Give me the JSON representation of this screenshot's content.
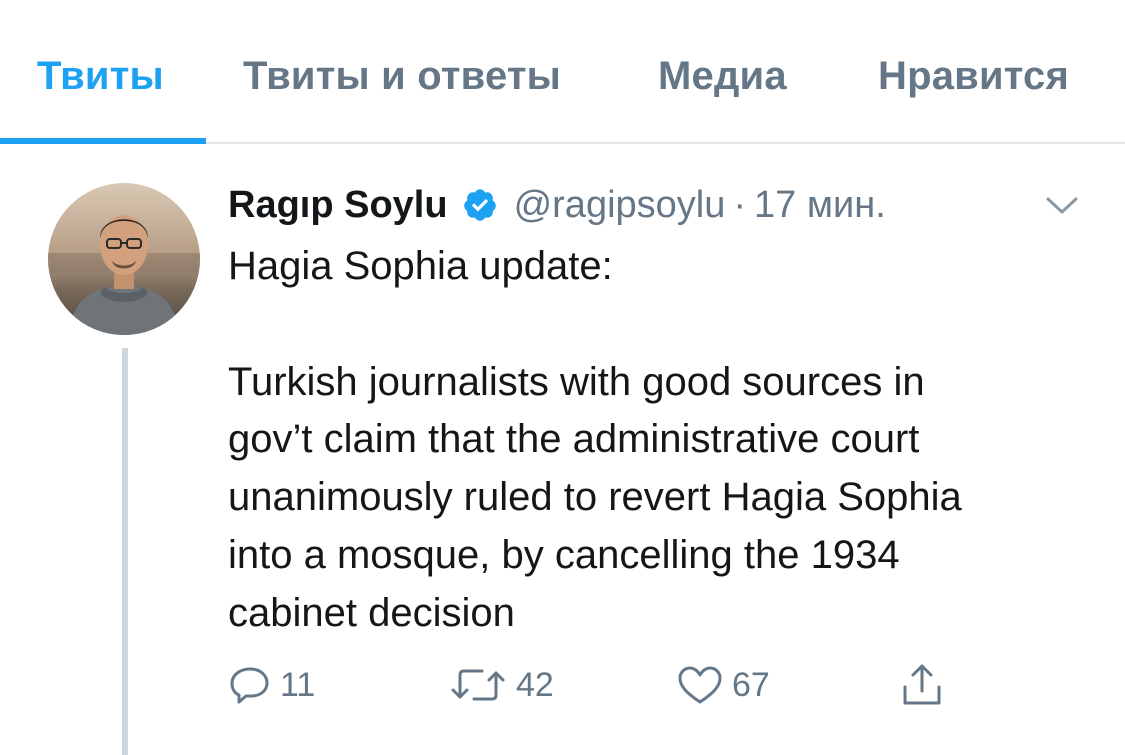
{
  "tabs": [
    {
      "label": "Твиты",
      "active": true
    },
    {
      "label": "Твиты и ответы",
      "active": false
    },
    {
      "label": "Медиа",
      "active": false
    },
    {
      "label": "Нравится",
      "active": false
    }
  ],
  "tweet": {
    "author_name": "Ragıp Soylu",
    "verified": true,
    "handle": "@ragipsoylu",
    "separator": "·",
    "time": "17 мин.",
    "text": "Hagia Sophia update:\n\nTurkish journalists with good sources in\ngov’t claim that the administrative court\nunanimously ruled to revert Hagia Sophia\ninto a mosque, by cancelling the 1934\ncabinet decision",
    "actions": {
      "reply": {
        "icon": "reply-icon",
        "count": "11"
      },
      "retweet": {
        "icon": "retweet-icon",
        "count": "42"
      },
      "like": {
        "icon": "heart-icon",
        "count": "67"
      },
      "share": {
        "icon": "share-icon"
      }
    }
  },
  "colors": {
    "accent": "#1da1f2",
    "secondary_text": "#657786",
    "primary_text": "#14171a",
    "thread_line": "#ccd6dd"
  }
}
